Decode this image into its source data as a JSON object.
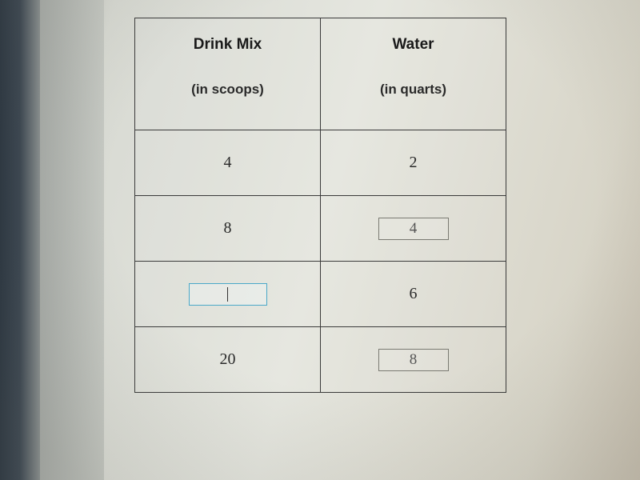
{
  "table": {
    "headers": {
      "col1_title": "Drink Mix",
      "col1_sub": "(in scoops)",
      "col2_title": "Water",
      "col2_sub": "(in quarts)"
    },
    "rows": [
      {
        "mix": "4",
        "water": "2",
        "mix_is_input": false,
        "water_is_input": false
      },
      {
        "mix": "8",
        "water": "4",
        "mix_is_input": false,
        "water_is_input": true
      },
      {
        "mix": "",
        "water": "6",
        "mix_is_input": true,
        "water_is_input": false,
        "mix_active": true
      },
      {
        "mix": "20",
        "water": "8",
        "mix_is_input": false,
        "water_is_input": true
      }
    ]
  }
}
